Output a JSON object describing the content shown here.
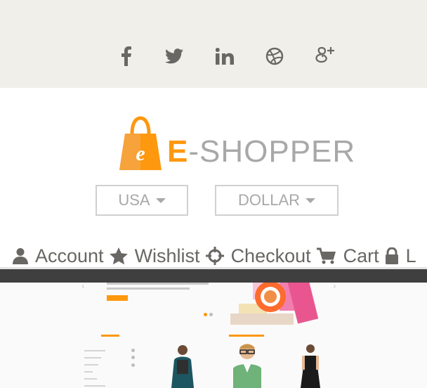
{
  "colors": {
    "topbar_bg": "#f0efe9",
    "brand_orange": "#fe980f",
    "nav_text": "#696763",
    "muted_text": "#a8a8a8",
    "strip": "#3f3f3f"
  },
  "social": [
    {
      "icon": "facebook-icon"
    },
    {
      "icon": "twitter-icon"
    },
    {
      "icon": "linkedin-icon"
    },
    {
      "icon": "dribbble-icon"
    },
    {
      "icon": "google-plus-icon"
    }
  ],
  "logo": {
    "bag_letter": "e",
    "accent": "E",
    "rest": "-SHOPPER"
  },
  "dropdowns": {
    "country": "USA",
    "currency": "DOLLAR"
  },
  "nav": {
    "account": "Account",
    "wishlist": "Wishlist",
    "checkout": "Checkout",
    "cart": "Cart",
    "login": "L"
  }
}
